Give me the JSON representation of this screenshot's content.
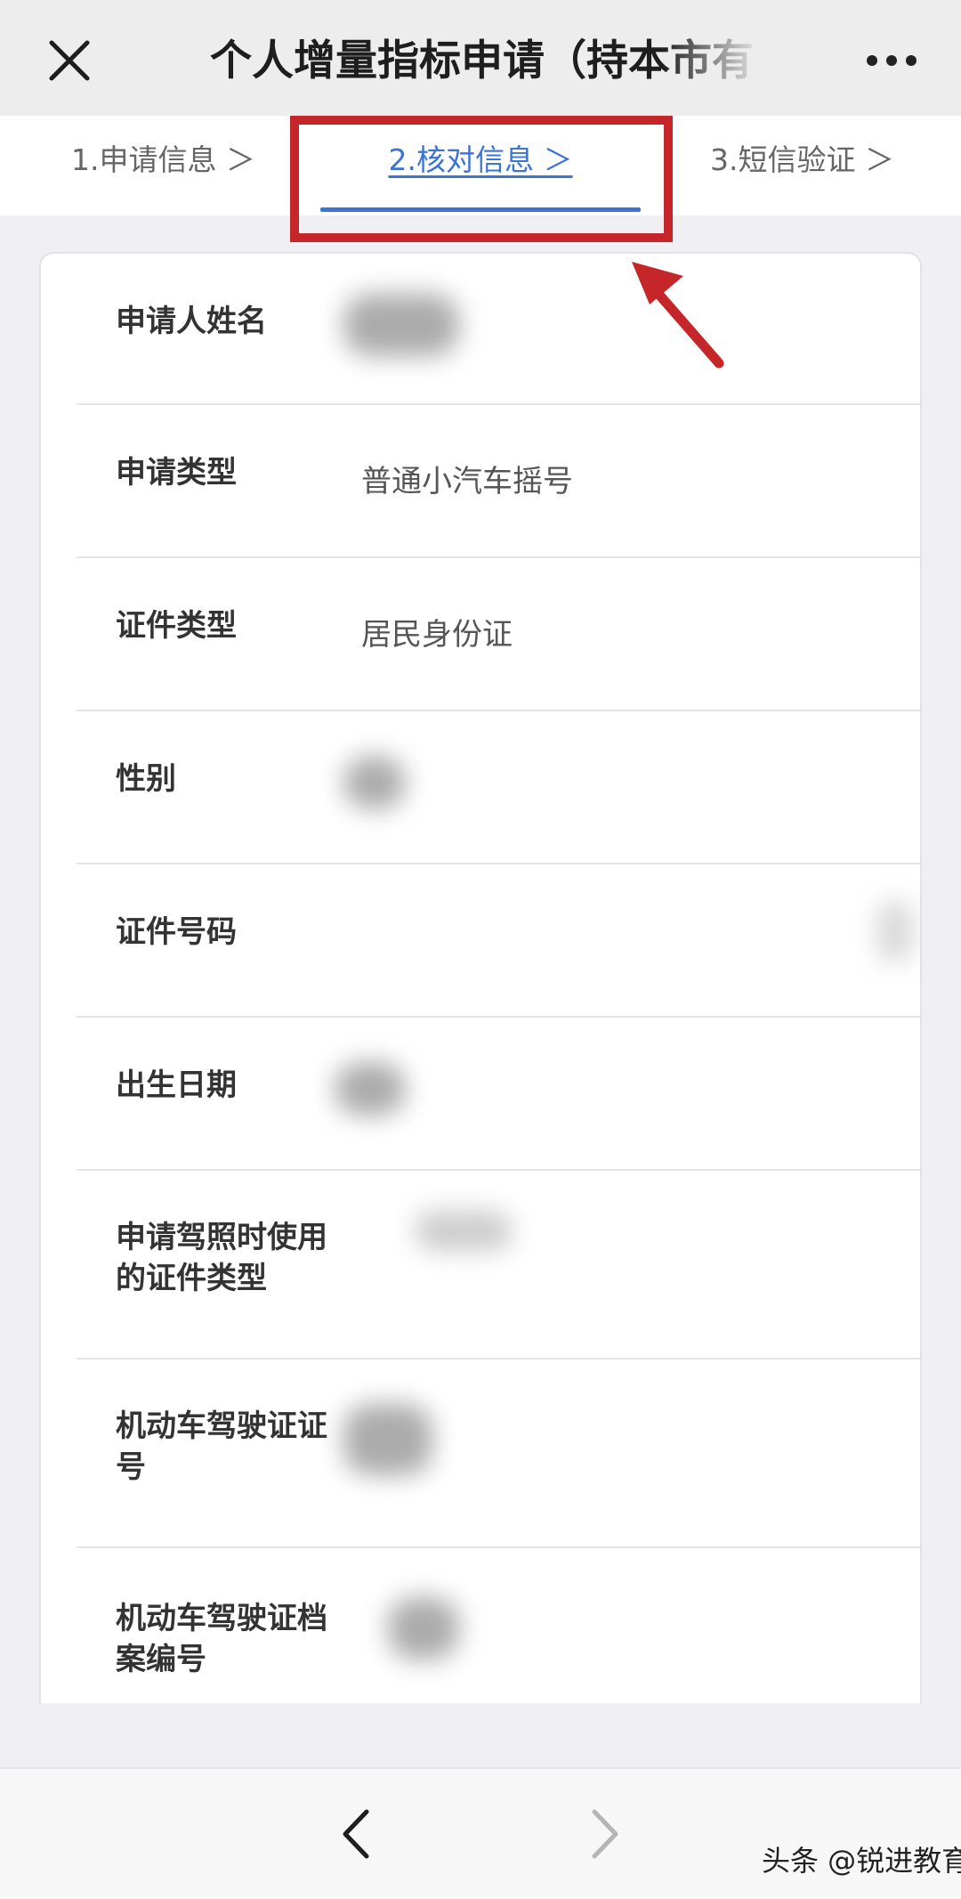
{
  "header": {
    "title": "个人增量指标申请（持本市有"
  },
  "steps": [
    {
      "label": "1.申请信息 ＞",
      "active": false
    },
    {
      "label": "2.核对信息 ＞",
      "active": true
    },
    {
      "label": "3.短信验证 ＞",
      "active": false
    }
  ],
  "form": {
    "rows": [
      {
        "label": "申请人姓名",
        "value": ""
      },
      {
        "label": "申请类型",
        "value": "普通小汽车摇号"
      },
      {
        "label": "证件类型",
        "value": "居民身份证"
      },
      {
        "label": "性别",
        "value": ""
      },
      {
        "label": "证件号码",
        "value": ""
      },
      {
        "label": "出生日期",
        "value": ""
      },
      {
        "label": "申请驾照时使用的证件类型",
        "value": ""
      },
      {
        "label": "机动车驾驶证证号",
        "value": ""
      },
      {
        "label": "机动车驾驶证档案编号",
        "value": ""
      }
    ]
  },
  "watermark": "头条 @锐进教育",
  "colors": {
    "active_step": "#3b74d9",
    "annotation": "#c4262a",
    "background": "#efeff4"
  },
  "icons": {
    "close": "close-icon",
    "more": "more-icon",
    "back": "chevron-left-icon",
    "forward": "chevron-right-icon"
  }
}
